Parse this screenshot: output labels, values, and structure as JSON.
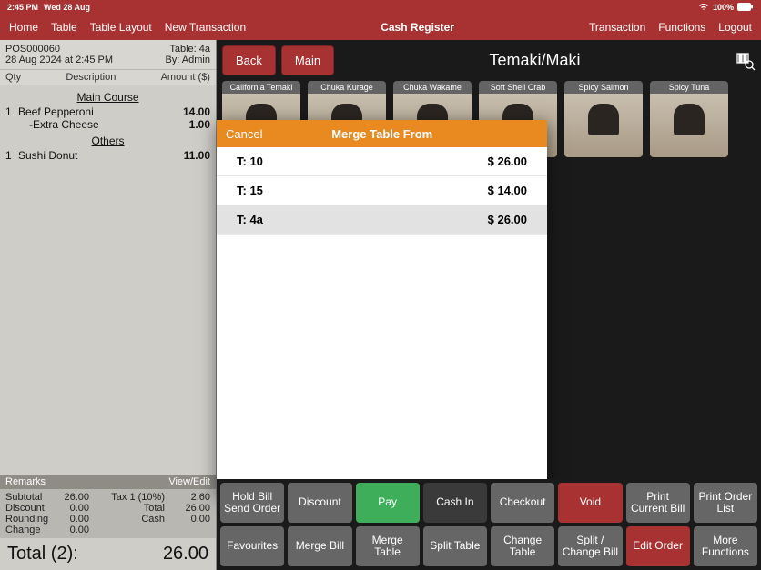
{
  "status": {
    "time": "2:45 PM",
    "date": "Wed 28 Aug",
    "battery": "100%"
  },
  "nav": {
    "items": [
      "Home",
      "Table",
      "Table Layout",
      "New Transaction"
    ],
    "title": "Cash Register",
    "right": [
      "Transaction",
      "Functions",
      "Logout"
    ]
  },
  "order": {
    "pos_id": "POS000060",
    "timestamp": "28 Aug 2024 at 2:45 PM",
    "table": "Table: 4a",
    "by": "By: Admin",
    "cols": {
      "qty": "Qty",
      "desc": "Description",
      "amount": "Amount ($)"
    },
    "courses": [
      {
        "title": "Main Course",
        "lines": [
          {
            "qty": "1",
            "desc": "Beef Pepperoni",
            "amt": "14.00"
          },
          {
            "qty": "",
            "desc": "-Extra Cheese",
            "amt": "1.00",
            "sub": true
          }
        ]
      },
      {
        "title": "Others",
        "lines": [
          {
            "qty": "1",
            "desc": "Sushi Donut",
            "amt": "11.00"
          }
        ]
      }
    ],
    "remarks": {
      "label": "Remarks",
      "view_edit": "View/Edit"
    },
    "totals": {
      "rows": [
        {
          "l1": "Subtotal",
          "v1": "26.00",
          "l2": "Tax 1 (10%)",
          "v2": "2.60"
        },
        {
          "l1": "Discount",
          "v1": "0.00",
          "l2": "Total",
          "v2": "26.00"
        },
        {
          "l1": "Rounding",
          "v1": "0.00",
          "l2": "Cash",
          "v2": "0.00"
        },
        {
          "l1": "Change",
          "v1": "0.00",
          "l2": "",
          "v2": ""
        }
      ]
    },
    "grand": {
      "label": "Total (2):",
      "value": "26.00"
    }
  },
  "icon_glyph": "▾",
  "catalog": {
    "back": "Back",
    "main": "Main",
    "category": "Temaki/Maki",
    "products": [
      "California Temaki",
      "Chuka Kurage",
      "Chuka Wakame",
      "Soft Shell Crab",
      "Spicy Salmon",
      "Spicy Tuna"
    ]
  },
  "actions": {
    "row1": [
      {
        "label": "Hold Bill\nSend Order",
        "style": "gray"
      },
      {
        "label": "Discount",
        "style": "gray"
      },
      {
        "label": "Pay",
        "style": "green"
      },
      {
        "label": "Cash In",
        "style": "dark"
      },
      {
        "label": "Checkout",
        "style": "gray"
      },
      {
        "label": "Void",
        "style": "red"
      },
      {
        "label": "Print\nCurrent Bill",
        "style": "gray"
      },
      {
        "label": "Print Order\nList",
        "style": "gray"
      }
    ],
    "row2": [
      {
        "label": "Favourites",
        "style": "gray"
      },
      {
        "label": "Merge Bill",
        "style": "gray"
      },
      {
        "label": "Merge Table",
        "style": "gray"
      },
      {
        "label": "Split Table",
        "style": "gray"
      },
      {
        "label": "Change\nTable",
        "style": "gray"
      },
      {
        "label": "Split /\nChange Bill",
        "style": "gray"
      },
      {
        "label": "Edit Order",
        "style": "red"
      },
      {
        "label": "More\nFunctions",
        "style": "gray"
      }
    ]
  },
  "modal": {
    "cancel": "Cancel",
    "title": "Merge Table From",
    "rows": [
      {
        "table": "T: 10",
        "amount": "$ 26.00",
        "selected": false
      },
      {
        "table": "T: 15",
        "amount": "$ 14.00",
        "selected": false
      },
      {
        "table": "T: 4a",
        "amount": "$ 26.00",
        "selected": true
      }
    ]
  }
}
